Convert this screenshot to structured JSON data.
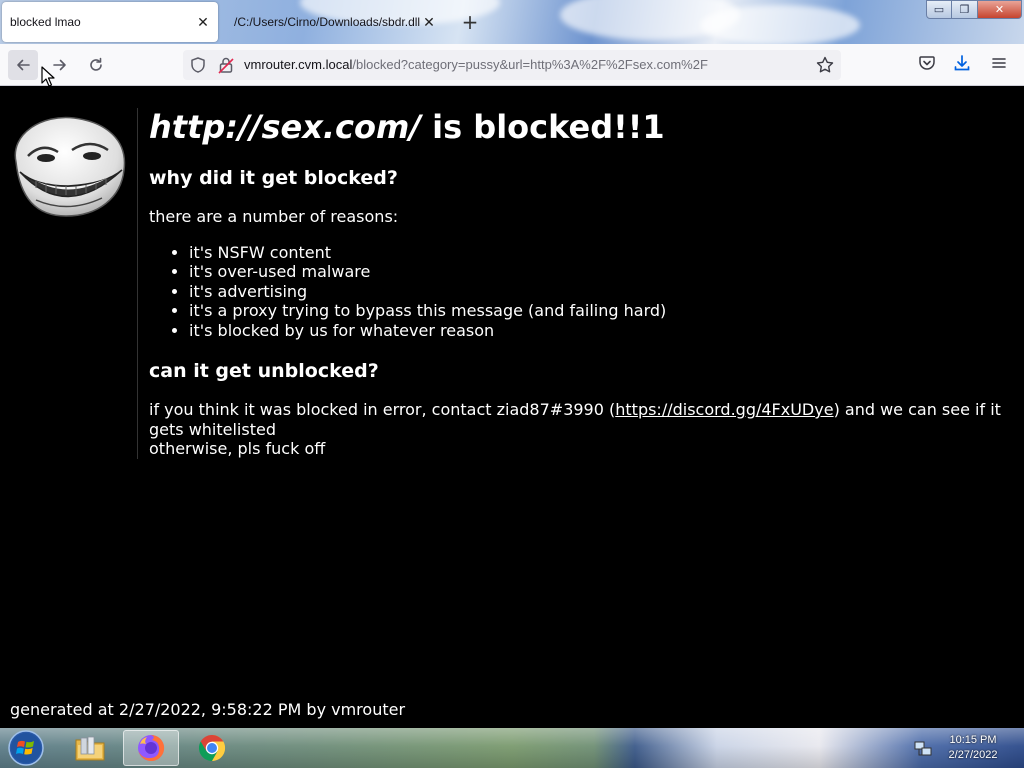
{
  "browser": {
    "tabs": [
      {
        "label": "blocked lmao",
        "active": true
      },
      {
        "label": "/C:/Users/Cirno/Downloads/sbdr.dll",
        "active": false
      }
    ],
    "new_tab_label": "+",
    "window_controls": {
      "minimize": "▭",
      "maximize": "❐",
      "close": "✕"
    },
    "address": {
      "host": "vmrouter.cvm.local",
      "path": "/blocked?category=pussy&url=http%3A%2F%2Fsex.com%2F"
    },
    "icons": [
      "back-arrow-icon",
      "forward-arrow-icon",
      "reload-icon",
      "shield-icon",
      "lock-icon",
      "star-icon",
      "pocket-icon",
      "download-icon",
      "hamburger-menu-icon"
    ]
  },
  "page": {
    "headline_url": "http://sex.com/",
    "headline_rest": " is blocked!!1",
    "why_heading": "why did it get blocked?",
    "reasons_intro": "there are a number of reasons:",
    "reasons": [
      "it's NSFW content",
      "it's over-used malware",
      "it's advertising",
      "it's a proxy trying to bypass this message (and failing hard)",
      "it's blocked by us for whatever reason"
    ],
    "unblock_heading": "can it get unblocked?",
    "contact_before": "if you think it was blocked in error, contact ziad87#3990 (",
    "discord_link": "https://discord.gg/4FxUDye",
    "contact_after": ") and we can see if it gets whitelisted",
    "otherwise": "otherwise, pls fuck off",
    "footer": "generated at 2/27/2022, 9:58:22 PM by vmrouter"
  },
  "taskbar": {
    "items": [
      "windows-start-icon",
      "file-explorer-icon",
      "firefox-icon",
      "chrome-icon"
    ],
    "clock_time": "10:15 PM",
    "clock_date": "2/27/2022"
  },
  "colors": {
    "page_background": "#000000",
    "page_text": "#ffffff",
    "toolbar": "#f9f9fb",
    "urlbar": "#f0f0f4"
  }
}
